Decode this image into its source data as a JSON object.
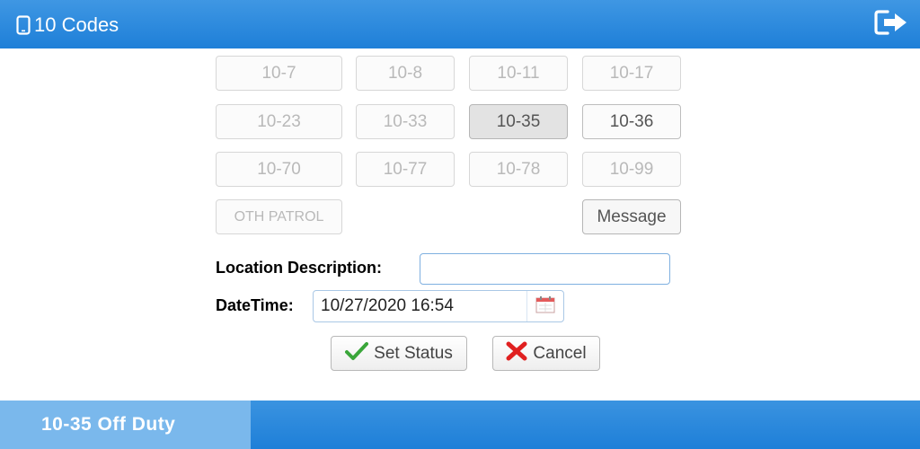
{
  "header": {
    "title": "10 Codes",
    "icons": {
      "app": "mobile-phone-icon",
      "exit": "sign-out-icon"
    }
  },
  "codes": {
    "row1": [
      "10-7",
      "10-8",
      "10-11",
      "10-17"
    ],
    "row2": [
      "10-23",
      "10-33",
      "10-35",
      "10-36"
    ],
    "row3": [
      "10-70",
      "10-77",
      "10-78",
      "10-99"
    ],
    "other": "OTH PATROL",
    "message": "Message",
    "selected": "10-35"
  },
  "form": {
    "location_label": "Location Description:",
    "location_value": "",
    "datetime_label": "DateTime:",
    "datetime_value": "10/27/2020 16:54",
    "calendar_icon": "calendar-icon"
  },
  "actions": {
    "set_status": "Set Status",
    "cancel": "Cancel"
  },
  "footer": {
    "status": "10-35 Off Duty"
  },
  "colors": {
    "header_blue": "#1e7fd8",
    "footer_status_bg": "#7ab8ec",
    "check_green": "#3aa63a",
    "cancel_red": "#e02020"
  }
}
